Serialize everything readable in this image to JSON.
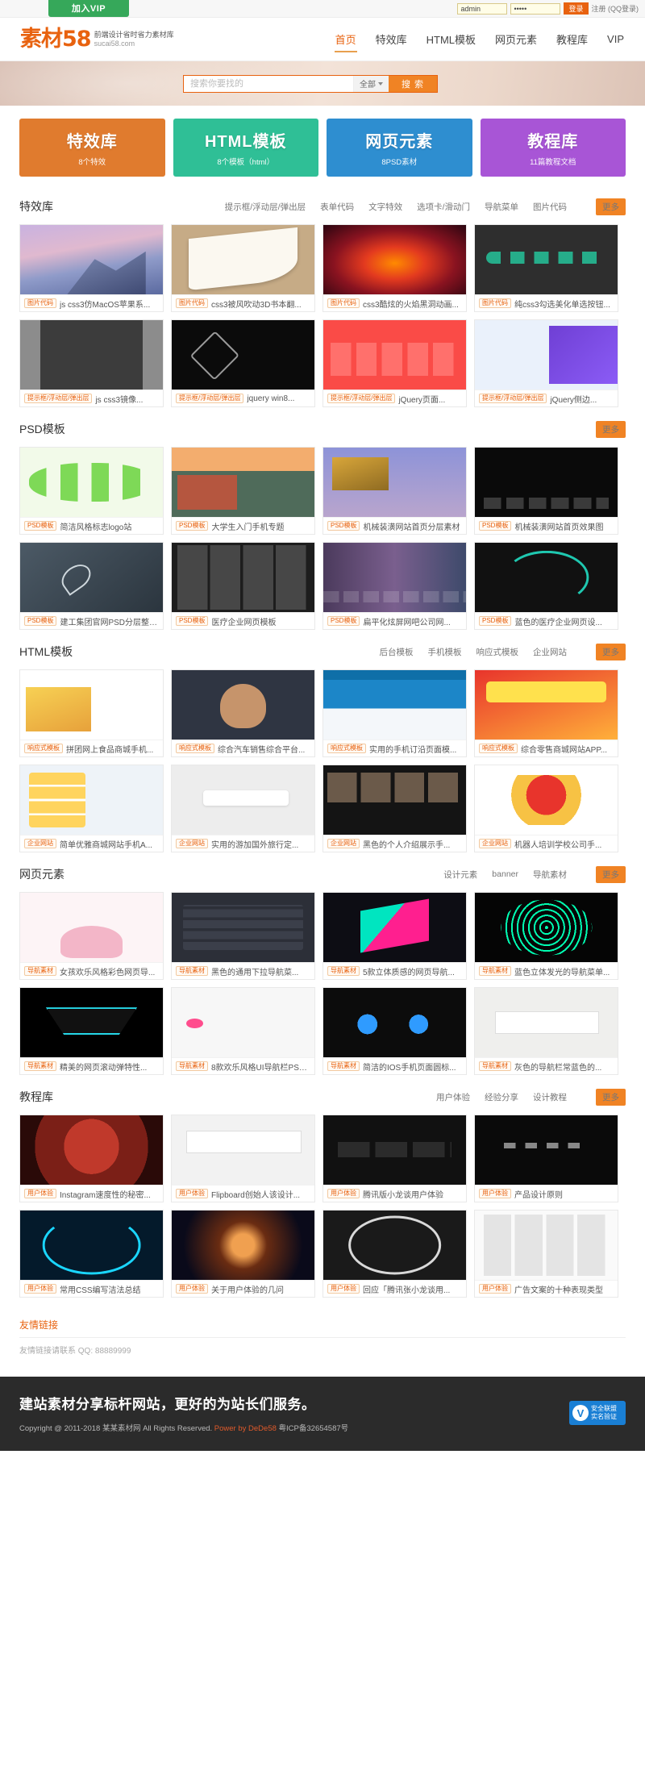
{
  "topbar": {
    "vip_label": "加入VIP",
    "username_value": "admin",
    "password_value": "•••••",
    "login_label": "登录",
    "register_label": "注册 (QQ登录)"
  },
  "header": {
    "logo_mark": "素材58",
    "logo_line1": "前端设计省时省力素材库",
    "logo_line2": "sucai58.com",
    "nav": [
      {
        "label": "首页",
        "active": true
      },
      {
        "label": "特效库",
        "active": false
      },
      {
        "label": "HTML模板",
        "active": false
      },
      {
        "label": "网页元素",
        "active": false
      },
      {
        "label": "教程库",
        "active": false
      },
      {
        "label": "VIP",
        "active": false
      }
    ]
  },
  "search": {
    "placeholder": "搜索你要找的",
    "value": "",
    "scope_label": "全部",
    "button_label": "搜 索"
  },
  "category_cards": [
    {
      "title": "特效库",
      "subtitle": "8个特效",
      "color": "#e07b2e"
    },
    {
      "title": "HTML模板",
      "subtitle": "8个模板（html）",
      "color": "#2fbf96"
    },
    {
      "title": "网页元素",
      "subtitle": "8PSD素材",
      "color": "#2e8ed0"
    },
    {
      "title": "教程库",
      "subtitle": "11篇教程文档",
      "color": "#a855d6"
    }
  ],
  "sections": [
    {
      "title": "特效库",
      "categories": [
        "提示框/浮动层/弹出层",
        "表单代码",
        "文字特效",
        "选项卡/滑动门",
        "导航菜单",
        "图片代码"
      ],
      "more_label": "更多",
      "rows": [
        [
          {
            "tag": "图片代码",
            "title": "js css3仿MacOS苹果系...",
            "art": "t-mac"
          },
          {
            "tag": "图片代码",
            "title": "css3被风吹动3D书本翻...",
            "art": "t-book"
          },
          {
            "tag": "图片代码",
            "title": "css3酷炫的火焰黑洞动画...",
            "art": "t-fire"
          },
          {
            "tag": "图片代码",
            "title": "纯css3勾选美化单选按钮...",
            "art": "t-toggle"
          }
        ],
        [
          {
            "tag": "提示框/浮动层/弹出层",
            "title": "js css3镜像...",
            "art": "t-dark-page"
          },
          {
            "tag": "提示框/浮动层/弹出层",
            "title": "jquery win8...",
            "art": "t-logo-dark"
          },
          {
            "tag": "提示框/浮动层/弹出层",
            "title": "jQuery页面...",
            "art": "t-hover"
          },
          {
            "tag": "提示框/浮动层/弹出层",
            "title": "jQuery侧边...",
            "art": "t-sidebar"
          }
        ]
      ]
    },
    {
      "title": "PSD模板",
      "categories": [],
      "more_label": "更多",
      "rows": [
        [
          {
            "tag": "PSD模板",
            "title": "简洁风格标志logo站",
            "art": "t-frog"
          },
          {
            "tag": "PSD模板",
            "title": "大学生入门手机专题",
            "art": "t-weather"
          },
          {
            "tag": "PSD模板",
            "title": "机械装潢网站首页分层素材",
            "art": "t-steps"
          },
          {
            "tag": "PSD模板",
            "title": "机械装潢网站首页效果图",
            "art": "t-black-ui"
          }
        ],
        [
          {
            "tag": "PSD模板",
            "title": "建工集团官网PSD分层整素...",
            "art": "t-chalk"
          },
          {
            "tag": "PSD模板",
            "title": "医疗企业网页模板",
            "art": "t-grid-dark"
          },
          {
            "tag": "PSD模板",
            "title": "扁平化炫屏网吧公司网...",
            "art": "t-purple-strip"
          },
          {
            "tag": "PSD模板",
            "title": "蓝色的医疗企业网页设...",
            "art": "t-timer"
          }
        ]
      ]
    },
    {
      "title": "HTML模板",
      "categories": [
        "后台模板",
        "手机模板",
        "响应式模板",
        "企业网站"
      ],
      "more_label": "更多",
      "rows": [
        [
          {
            "tag": "响应式模板",
            "title": "拼团网上食品商城手机...",
            "art": "t-shop"
          },
          {
            "tag": "响应式模板",
            "title": "综合汽车销售综合平台...",
            "art": "t-person"
          },
          {
            "tag": "响应式模板",
            "title": "实用的手机订沿页面模...",
            "art": "t-blue-site"
          },
          {
            "tag": "响应式模板",
            "title": "综合零售商城网站APP...",
            "art": "t-red-promo"
          }
        ],
        [
          {
            "tag": "企业网站",
            "title": "简单优雅商城网站手机A...",
            "art": "t-mobile-app"
          },
          {
            "tag": "企业网站",
            "title": "实用的游加国外旅行定...",
            "art": "t-chat"
          },
          {
            "tag": "企业网站",
            "title": "黑色的个人介绍展示手...",
            "art": "t-gallery"
          },
          {
            "tag": "企业网站",
            "title": "机器人培训学校公司手...",
            "art": "t-festive"
          }
        ]
      ]
    },
    {
      "title": "网页元素",
      "categories": [
        "设计元素",
        "banner",
        "导航素材"
      ],
      "more_label": "更多",
      "rows": [
        [
          {
            "tag": "导航素材",
            "title": "女孩欢乐风格彩色网页导...",
            "art": "t-lotus"
          },
          {
            "tag": "导航素材",
            "title": "黑色的通用下拉导航菜...",
            "art": "t-dropdown"
          },
          {
            "tag": "导航素材",
            "title": "5款立体质感的网页导航...",
            "art": "t-cube"
          },
          {
            "tag": "导航素材",
            "title": "蓝色立体发光的导航菜单...",
            "art": "t-spiral"
          }
        ],
        [
          {
            "tag": "导航素材",
            "title": "精美的网页滚动弹特性...",
            "art": "t-robot"
          },
          {
            "tag": "导航素材",
            "title": "8款欢乐风格UI导航栏PS素材",
            "art": "t-choice"
          },
          {
            "tag": "导航素材",
            "title": "简洁的IOS手机页面圆标...",
            "art": "t-dots"
          },
          {
            "tag": "导航素材",
            "title": "灰色的导航栏常蓝色的...",
            "art": "t-coffee"
          }
        ]
      ]
    },
    {
      "title": "教程库",
      "categories": [
        "用户体验",
        "经验分享",
        "设计教程"
      ],
      "more_label": "更多",
      "rows": [
        [
          {
            "tag": "用户体验",
            "title": "Instagram速度性的秘密...",
            "art": "t-red-circle"
          },
          {
            "tag": "用户体验",
            "title": "Flipboard创始人该设计...",
            "art": "t-flip"
          },
          {
            "tag": "用户体验",
            "title": "腾讯版小龙谈用户体验",
            "art": "t-clockwise"
          },
          {
            "tag": "用户体验",
            "title": "产品设计原则",
            "art": "t-oadi"
          }
        ],
        [
          {
            "tag": "用户体验",
            "title": "常用CSS编写洁法总结",
            "art": "t-neon-car"
          },
          {
            "tag": "用户体验",
            "title": "关于用户体验的几问",
            "art": "t-space"
          },
          {
            "tag": "用户体验",
            "title": "回应「腾讯张小龙谈用...",
            "art": "t-gauge"
          },
          {
            "tag": "用户体验",
            "title": "广告文案的十种表现类型",
            "art": "t-ads"
          }
        ]
      ]
    }
  ],
  "friend_links": {
    "title": "友情链接",
    "text": "友情链接请联系 QQ: 88889999"
  },
  "footer": {
    "slogan": "建站素材分享标杆网站，更好的为站长们服务。",
    "copyright_pre": "Copyright @ 2011-2018 某某素材网 All Rights Reserved. ",
    "power": "Power by DeDe58",
    "icp": " 粤ICP备32654587号",
    "badge_line1": "安全联盟",
    "badge_line2": "实名验证",
    "badge_letter": "V"
  }
}
